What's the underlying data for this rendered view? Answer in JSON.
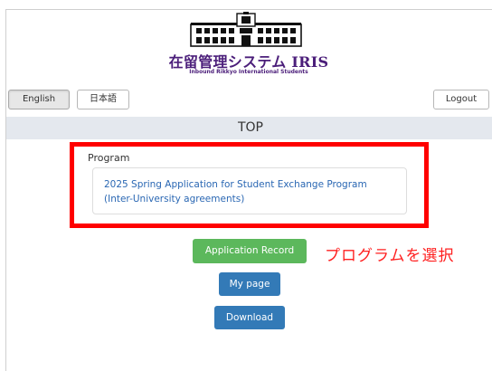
{
  "header": {
    "title": "在留管理システム IRIS",
    "subtitle": "Inbound Rikkyo International Students",
    "logo_icon": "building-logo-icon"
  },
  "language": {
    "english_label": "English",
    "japanese_label": "日本語",
    "selected": "English"
  },
  "account": {
    "logout_label": "Logout"
  },
  "page": {
    "title": "TOP"
  },
  "program": {
    "label": "Program",
    "value_line1": "2025 Spring Application for Student Exchange Program",
    "value_line2": "(Inter-University agreements)"
  },
  "actions": {
    "application_record_label": "Application Record",
    "my_page_label": "My page",
    "download_label": "Download"
  },
  "annotation": {
    "text": "プログラムを選択"
  },
  "colors": {
    "brand_purple": "#4b1e7a",
    "highlight_red": "#ff0000",
    "success_green": "#5cb85c",
    "primary_blue": "#337ab7",
    "link_blue": "#2a67b3",
    "top_bar_bg": "#e4e8ee"
  }
}
